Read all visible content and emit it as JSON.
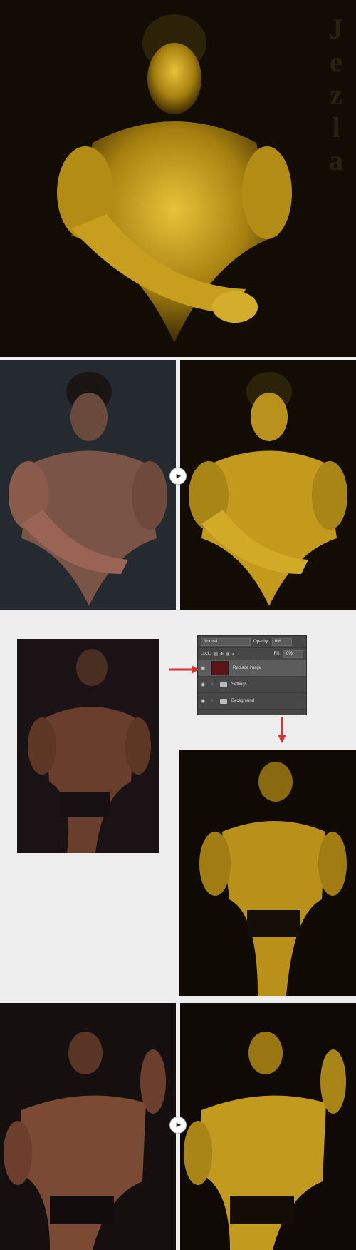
{
  "watermark": {
    "letters": [
      "J",
      "e",
      "z",
      "l",
      "a"
    ]
  },
  "layers_panel": {
    "blend_mode": "Normal",
    "opacity_label": "Opacity:",
    "opacity_value": "0%",
    "lock_label": "Lock:",
    "fill_label": "Fill:",
    "fill_value": "0%",
    "layers": [
      {
        "name": "Replace image",
        "type": "smart-object",
        "active": true
      },
      {
        "name": "Settings",
        "type": "group",
        "active": false
      },
      {
        "name": "Background",
        "type": "group",
        "active": false
      }
    ]
  },
  "icons": {
    "arrow": "play-arrow-icon",
    "eye": "eye-icon"
  },
  "colors": {
    "gold": "#c9a21a",
    "dark_bg": "#120c05",
    "red_arrow": "#e03030"
  }
}
